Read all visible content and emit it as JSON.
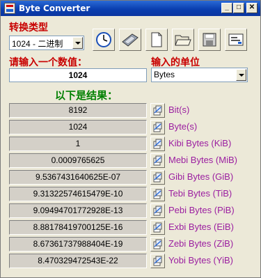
{
  "window": {
    "title": "Byte Converter"
  },
  "type_section": {
    "label": "转换类型",
    "selected": "1024 - 二进制"
  },
  "toolbar": {
    "buttons": [
      {
        "name": "clock-button",
        "icon": "clock-icon"
      },
      {
        "name": "calculator-button",
        "icon": "calculator-icon"
      },
      {
        "name": "new-button",
        "icon": "new-document-icon"
      },
      {
        "name": "open-button",
        "icon": "open-folder-icon"
      },
      {
        "name": "save-button",
        "icon": "save-disk-icon"
      },
      {
        "name": "about-button",
        "icon": "info-window-icon"
      }
    ]
  },
  "input": {
    "label": "请输入一个数值：",
    "value": "1024"
  },
  "unit_select": {
    "label": "输入的单位",
    "selected": "Bytes"
  },
  "results": {
    "label": "以下是结果：",
    "rows": [
      {
        "value": "8192",
        "unit": "Bit(s)"
      },
      {
        "value": "1024",
        "unit": "Byte(s)"
      },
      {
        "value": "1",
        "unit": "Kibi Bytes (KiB)"
      },
      {
        "value": "0.0009765625",
        "unit": "Mebi Bytes (MiB)"
      },
      {
        "value": "9.5367431640625E-07",
        "unit": "Gibi Bytes (GiB)"
      },
      {
        "value": "9.31322574615479E-10",
        "unit": "Tebi Bytes (TiB)"
      },
      {
        "value": "9.09494701772928E-13",
        "unit": "Pebi Bytes (PiB)"
      },
      {
        "value": "8.88178419700125E-16",
        "unit": "Exbi Bytes (EiB)"
      },
      {
        "value": "8.67361737988404E-19",
        "unit": "Zebi Bytes (ZiB)"
      },
      {
        "value": "8.470329472543E-22",
        "unit": "Yobi Bytes (YiB)"
      }
    ]
  },
  "colors": {
    "title_bar": "#0a3fb0",
    "section_label": "#c80000",
    "results_label": "#008000",
    "unit_text": "#9b1ea0"
  }
}
